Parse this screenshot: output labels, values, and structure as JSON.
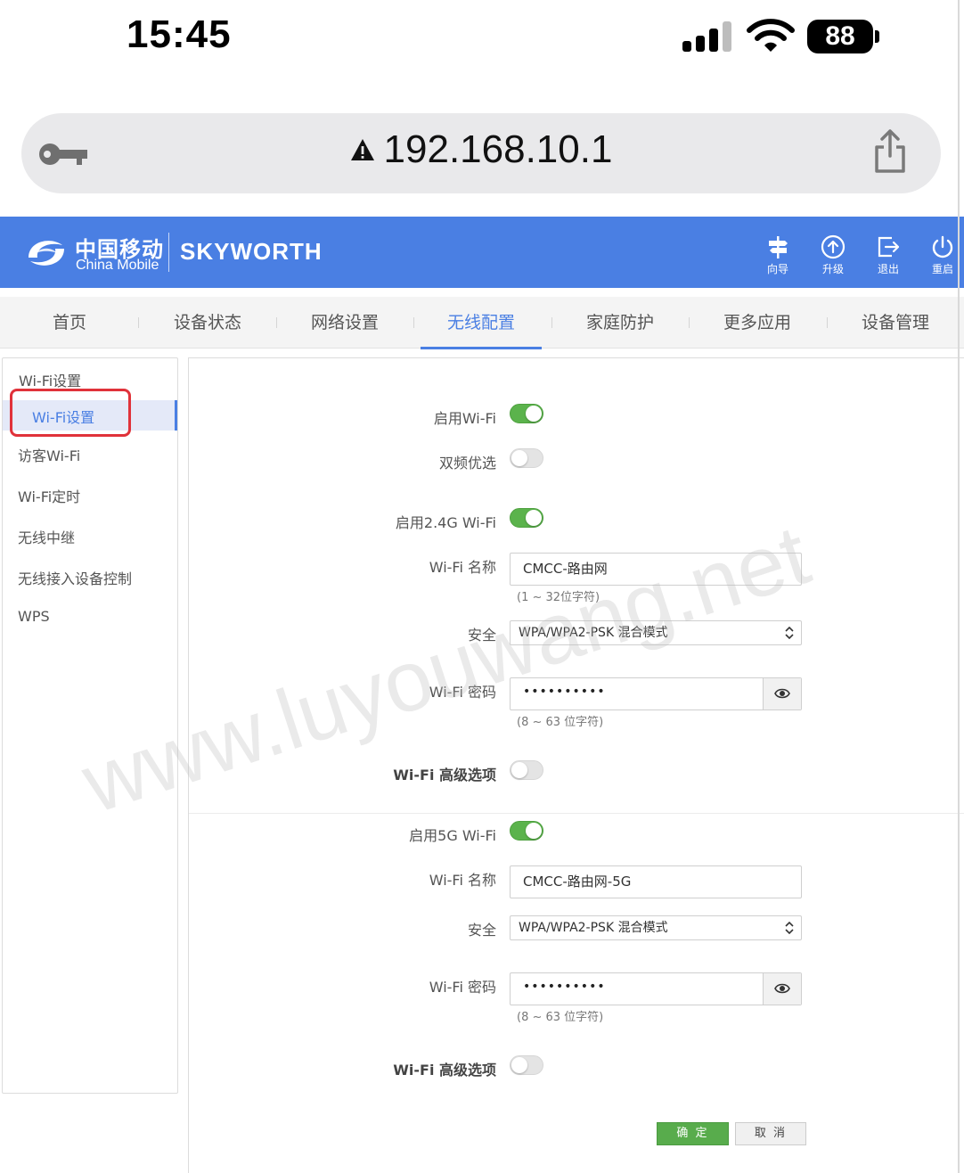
{
  "status_bar": {
    "time": "15:45",
    "battery": "88"
  },
  "browser": {
    "url": "192.168.10.1"
  },
  "header": {
    "logo_cn": "中国移动",
    "logo_en": "China Mobile",
    "brand": "SKYWORTH",
    "buttons": [
      {
        "label": "向导",
        "icon": "signpost-icon"
      },
      {
        "label": "升级",
        "icon": "upgrade-icon"
      },
      {
        "label": "退出",
        "icon": "logout-icon"
      },
      {
        "label": "重启",
        "icon": "power-icon"
      }
    ]
  },
  "nav": {
    "tabs": [
      {
        "label": "首页"
      },
      {
        "label": "设备状态"
      },
      {
        "label": "网络设置"
      },
      {
        "label": "无线配置",
        "active": true
      },
      {
        "label": "家庭防护"
      },
      {
        "label": "更多应用"
      },
      {
        "label": "设备管理"
      }
    ]
  },
  "sidebar": {
    "group": "Wi-Fi设置",
    "active_item": "Wi-Fi设置",
    "items": [
      "访客Wi-Fi",
      "Wi-Fi定时",
      "无线中继",
      "无线接入设备控制",
      "WPS"
    ]
  },
  "form": {
    "enable_wifi": {
      "label": "启用Wi-Fi",
      "on": true
    },
    "dual_band": {
      "label": "双频优选",
      "on": false
    },
    "band24": {
      "enable": {
        "label": "启用2.4G Wi-Fi",
        "on": true
      },
      "ssid_label": "Wi-Fi 名称",
      "ssid": "CMCC-路由网",
      "ssid_hint": "(1 ~ 32位字符)",
      "security_label": "安全",
      "security": "WPA/WPA2-PSK 混合模式",
      "password_label": "Wi-Fi 密码",
      "password": "••••••••••",
      "password_hint": "(8 ~ 63 位字符)",
      "advanced": {
        "label": "Wi-Fi 高级选项",
        "on": false
      }
    },
    "band5": {
      "enable": {
        "label": "启用5G Wi-Fi",
        "on": true
      },
      "ssid_label": "Wi-Fi 名称",
      "ssid": "CMCC-路由网-5G",
      "security_label": "安全",
      "security": "WPA/WPA2-PSK 混合模式",
      "password_label": "Wi-Fi 密码",
      "password": "••••••••••",
      "password_hint": "(8 ~ 63 位字符)",
      "advanced": {
        "label": "Wi-Fi 高级选项",
        "on": false
      }
    },
    "buttons": {
      "ok": "确 定",
      "cancel": "取 消"
    }
  },
  "watermark": {
    "text": "www.luyouwang.net"
  },
  "colors": {
    "accent": "#4a7fe3",
    "toggle_on": "#5bb34c",
    "highlight": "#e0323a"
  }
}
